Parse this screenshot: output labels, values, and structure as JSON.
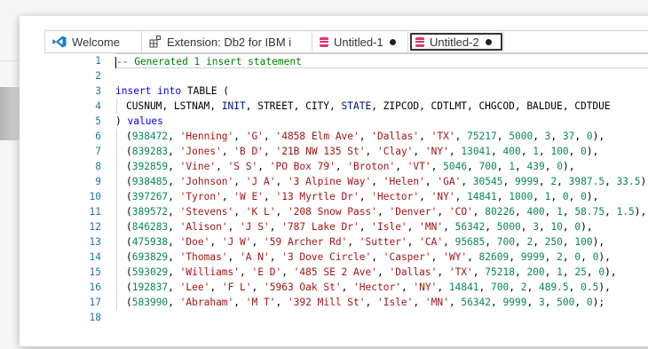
{
  "tabs": [
    {
      "label": "Welcome",
      "icon": "vscode-icon"
    },
    {
      "label": "Extension: Db2 for IBM i",
      "icon": "extension-icon"
    },
    {
      "label": "Untitled-1",
      "icon": "database-icon",
      "modified": true
    },
    {
      "label": "Untitled-2",
      "icon": "database-icon",
      "modified": true,
      "active": true
    }
  ],
  "colors": {
    "keyword": "#0000ff",
    "comment": "#008000",
    "string": "#a31515",
    "number": "#098658",
    "line_number": "#237893",
    "db_icon": "#e0356a"
  },
  "editor": {
    "lines": [
      {
        "n": "1",
        "text": "-- Generated 1 insert statement"
      },
      {
        "n": "2",
        "text": ""
      },
      {
        "n": "3",
        "text": "insert into TABLE ("
      },
      {
        "n": "4",
        "text": "CUSNUM, LSTNAM, INIT, STREET, CITY, STATE, ZIPCOD, CDTLMT, CHGCOD, BALDUE, CDTDUE"
      },
      {
        "n": "5",
        "text": ") values"
      },
      {
        "n": "6",
        "text": "(938472, 'Henning', 'G', '4858 Elm Ave', 'Dallas', 'TX', 75217, 5000, 3, 37, 0),"
      },
      {
        "n": "7",
        "text": "(839283, 'Jones', 'B D', '21B NW 135 St', 'Clay', 'NY', 13041, 400, 1, 100, 0),"
      },
      {
        "n": "8",
        "text": "(392859, 'Vine', 'S S', 'PO Box 79', 'Broton', 'VT', 5046, 700, 1, 439, 0),"
      },
      {
        "n": "9",
        "text": "(938485, 'Johnson', 'J A', '3 Alpine Way', 'Helen', 'GA', 30545, 9999, 2, 3987.5, 33.5),"
      },
      {
        "n": "10",
        "text": "(397267, 'Tyron', 'W E', '13 Myrtle Dr', 'Hector', 'NY', 14841, 1000, 1, 0, 0),"
      },
      {
        "n": "11",
        "text": "(389572, 'Stevens', 'K L', '208 Snow Pass', 'Denver', 'CO', 80226, 400, 1, 58.75, 1.5),"
      },
      {
        "n": "12",
        "text": "(846283, 'Alison', 'J S', '787 Lake Dr', 'Isle', 'MN', 56342, 5000, 3, 10, 0),"
      },
      {
        "n": "13",
        "text": "(475938, 'Doe', 'J W', '59 Archer Rd', 'Sutter', 'CA', 95685, 700, 2, 250, 100),"
      },
      {
        "n": "14",
        "text": "(693829, 'Thomas', 'A N', '3 Dove Circle', 'Casper', 'WY', 82609, 9999, 2, 0, 0),"
      },
      {
        "n": "15",
        "text": "(593029, 'Williams', 'E D', '485 SE 2 Ave', 'Dallas', 'TX', 75218, 200, 1, 25, 0),"
      },
      {
        "n": "16",
        "text": "(192837, 'Lee', 'F L', '5963 Oak St', 'Hector', 'NY', 14841, 700, 2, 489.5, 0.5),"
      },
      {
        "n": "17",
        "text": "(583990, 'Abraham', 'M T', '392 Mill St', 'Isle', 'MN', 56342, 9999, 3, 500, 0);"
      },
      {
        "n": "18",
        "text": ""
      }
    ]
  }
}
